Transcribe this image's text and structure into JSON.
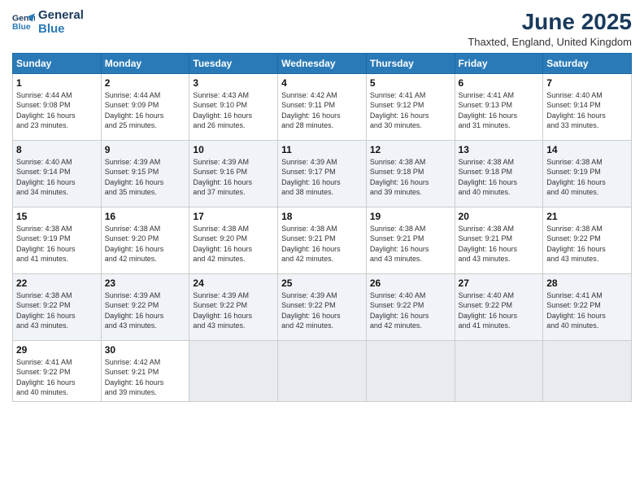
{
  "header": {
    "logo_general": "General",
    "logo_blue": "Blue",
    "month_year": "June 2025",
    "location": "Thaxted, England, United Kingdom"
  },
  "weekdays": [
    "Sunday",
    "Monday",
    "Tuesday",
    "Wednesday",
    "Thursday",
    "Friday",
    "Saturday"
  ],
  "weeks": [
    [
      {
        "day": "1",
        "info": "Sunrise: 4:44 AM\nSunset: 9:08 PM\nDaylight: 16 hours\nand 23 minutes."
      },
      {
        "day": "2",
        "info": "Sunrise: 4:44 AM\nSunset: 9:09 PM\nDaylight: 16 hours\nand 25 minutes."
      },
      {
        "day": "3",
        "info": "Sunrise: 4:43 AM\nSunset: 9:10 PM\nDaylight: 16 hours\nand 26 minutes."
      },
      {
        "day": "4",
        "info": "Sunrise: 4:42 AM\nSunset: 9:11 PM\nDaylight: 16 hours\nand 28 minutes."
      },
      {
        "day": "5",
        "info": "Sunrise: 4:41 AM\nSunset: 9:12 PM\nDaylight: 16 hours\nand 30 minutes."
      },
      {
        "day": "6",
        "info": "Sunrise: 4:41 AM\nSunset: 9:13 PM\nDaylight: 16 hours\nand 31 minutes."
      },
      {
        "day": "7",
        "info": "Sunrise: 4:40 AM\nSunset: 9:14 PM\nDaylight: 16 hours\nand 33 minutes."
      }
    ],
    [
      {
        "day": "8",
        "info": "Sunrise: 4:40 AM\nSunset: 9:14 PM\nDaylight: 16 hours\nand 34 minutes."
      },
      {
        "day": "9",
        "info": "Sunrise: 4:39 AM\nSunset: 9:15 PM\nDaylight: 16 hours\nand 35 minutes."
      },
      {
        "day": "10",
        "info": "Sunrise: 4:39 AM\nSunset: 9:16 PM\nDaylight: 16 hours\nand 37 minutes."
      },
      {
        "day": "11",
        "info": "Sunrise: 4:39 AM\nSunset: 9:17 PM\nDaylight: 16 hours\nand 38 minutes."
      },
      {
        "day": "12",
        "info": "Sunrise: 4:38 AM\nSunset: 9:18 PM\nDaylight: 16 hours\nand 39 minutes."
      },
      {
        "day": "13",
        "info": "Sunrise: 4:38 AM\nSunset: 9:18 PM\nDaylight: 16 hours\nand 40 minutes."
      },
      {
        "day": "14",
        "info": "Sunrise: 4:38 AM\nSunset: 9:19 PM\nDaylight: 16 hours\nand 40 minutes."
      }
    ],
    [
      {
        "day": "15",
        "info": "Sunrise: 4:38 AM\nSunset: 9:19 PM\nDaylight: 16 hours\nand 41 minutes."
      },
      {
        "day": "16",
        "info": "Sunrise: 4:38 AM\nSunset: 9:20 PM\nDaylight: 16 hours\nand 42 minutes."
      },
      {
        "day": "17",
        "info": "Sunrise: 4:38 AM\nSunset: 9:20 PM\nDaylight: 16 hours\nand 42 minutes."
      },
      {
        "day": "18",
        "info": "Sunrise: 4:38 AM\nSunset: 9:21 PM\nDaylight: 16 hours\nand 42 minutes."
      },
      {
        "day": "19",
        "info": "Sunrise: 4:38 AM\nSunset: 9:21 PM\nDaylight: 16 hours\nand 43 minutes."
      },
      {
        "day": "20",
        "info": "Sunrise: 4:38 AM\nSunset: 9:21 PM\nDaylight: 16 hours\nand 43 minutes."
      },
      {
        "day": "21",
        "info": "Sunrise: 4:38 AM\nSunset: 9:22 PM\nDaylight: 16 hours\nand 43 minutes."
      }
    ],
    [
      {
        "day": "22",
        "info": "Sunrise: 4:38 AM\nSunset: 9:22 PM\nDaylight: 16 hours\nand 43 minutes."
      },
      {
        "day": "23",
        "info": "Sunrise: 4:39 AM\nSunset: 9:22 PM\nDaylight: 16 hours\nand 43 minutes."
      },
      {
        "day": "24",
        "info": "Sunrise: 4:39 AM\nSunset: 9:22 PM\nDaylight: 16 hours\nand 43 minutes."
      },
      {
        "day": "25",
        "info": "Sunrise: 4:39 AM\nSunset: 9:22 PM\nDaylight: 16 hours\nand 42 minutes."
      },
      {
        "day": "26",
        "info": "Sunrise: 4:40 AM\nSunset: 9:22 PM\nDaylight: 16 hours\nand 42 minutes."
      },
      {
        "day": "27",
        "info": "Sunrise: 4:40 AM\nSunset: 9:22 PM\nDaylight: 16 hours\nand 41 minutes."
      },
      {
        "day": "28",
        "info": "Sunrise: 4:41 AM\nSunset: 9:22 PM\nDaylight: 16 hours\nand 40 minutes."
      }
    ],
    [
      {
        "day": "29",
        "info": "Sunrise: 4:41 AM\nSunset: 9:22 PM\nDaylight: 16 hours\nand 40 minutes."
      },
      {
        "day": "30",
        "info": "Sunrise: 4:42 AM\nSunset: 9:21 PM\nDaylight: 16 hours\nand 39 minutes."
      },
      {
        "day": "",
        "info": ""
      },
      {
        "day": "",
        "info": ""
      },
      {
        "day": "",
        "info": ""
      },
      {
        "day": "",
        "info": ""
      },
      {
        "day": "",
        "info": ""
      }
    ]
  ]
}
